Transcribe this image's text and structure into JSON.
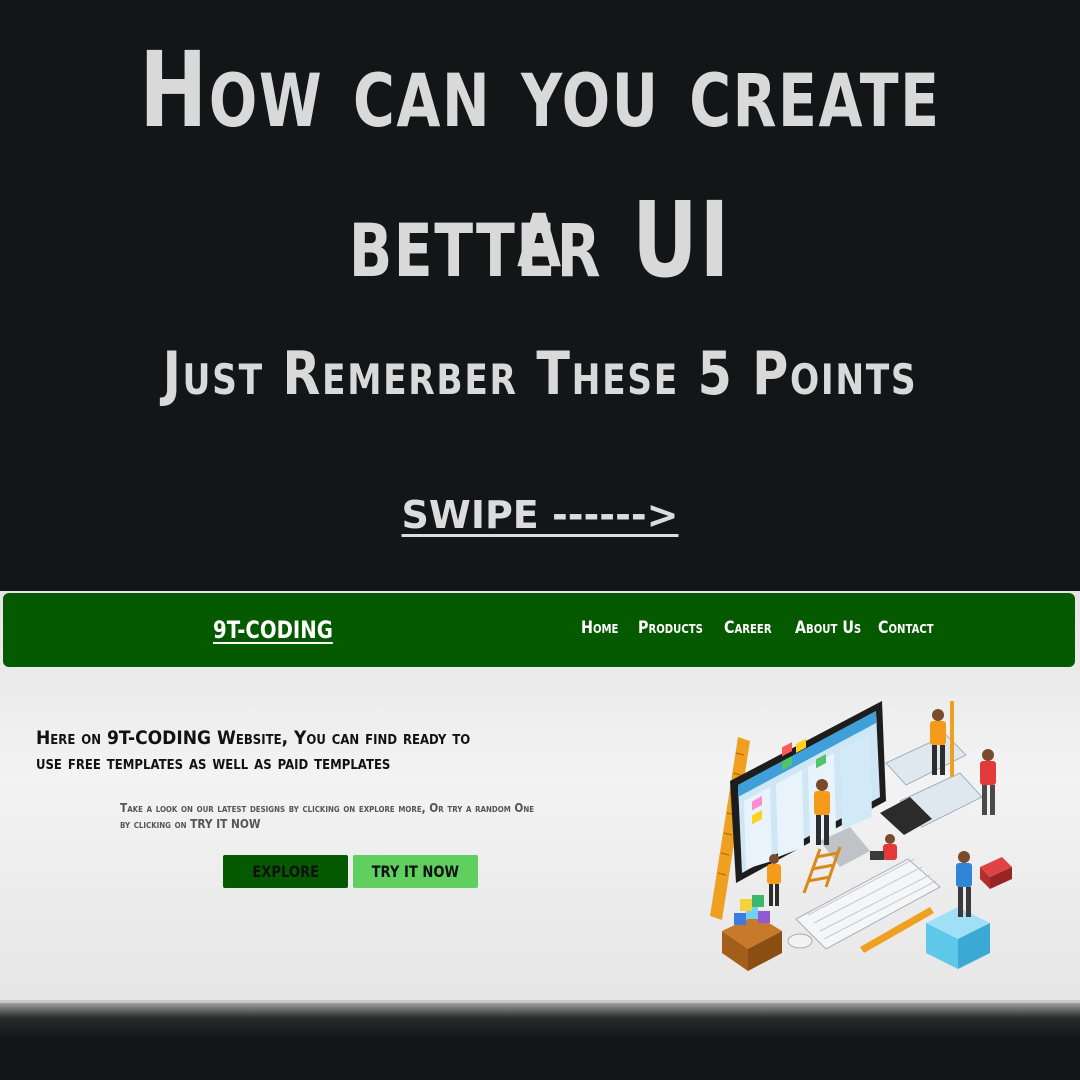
{
  "poster": {
    "headline_line1": "How can you create a",
    "headline_line2": "better UI",
    "subheadline": "Just Remerber These 5 Points",
    "swipe_label": "SWIPE ------>"
  },
  "site": {
    "logo": "9T-CODING",
    "nav": [
      "Home",
      "Products",
      "Career",
      "About Us",
      "Contact"
    ],
    "hero_title": "Here on 9T-CODING Website, You can find ready to use free templates as well as paid templates",
    "hero_description": "Take a look on our latest designs by clicking on explore more, Or try a random One by clicking on TRY IT NOW",
    "buttons": {
      "explore": "EXPLORE",
      "try_it_now": "TRY IT NOW"
    },
    "illustration_icon": "team-building-dashboard-illustration"
  },
  "colors": {
    "poster_background": "#121616",
    "poster_text": "#d9d9d9",
    "nav_background": "#055a00",
    "explore_button": "#055a00",
    "try_button": "#5fd05f"
  }
}
